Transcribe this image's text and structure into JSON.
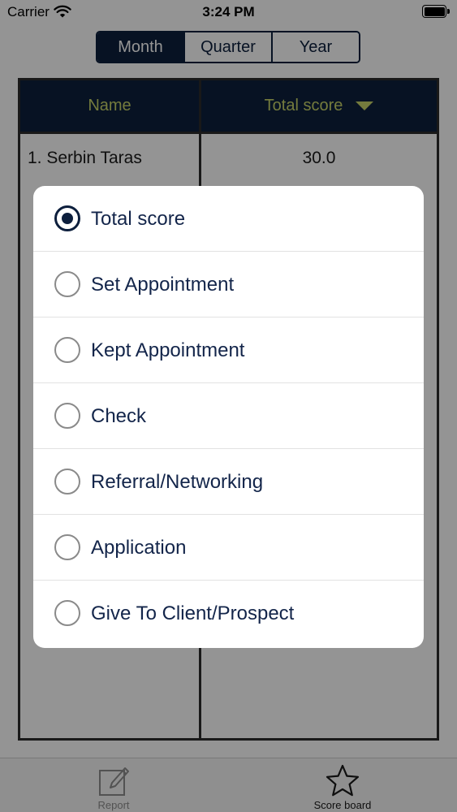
{
  "status_bar": {
    "carrier": "Carrier",
    "time": "3:24 PM"
  },
  "segmented": {
    "items": [
      "Month",
      "Quarter",
      "Year"
    ],
    "selected": "Month"
  },
  "table": {
    "headers": {
      "name": "Name",
      "score": "Total score"
    },
    "rows": [
      {
        "name": "1. Serbin Taras",
        "score": "30.0"
      }
    ]
  },
  "tab_bar": {
    "report_label": "Report",
    "score_label": "Score board"
  },
  "sort_menu": {
    "selected": "Total score",
    "options": [
      "Total score",
      "Set Appointment",
      "Kept Appointment",
      "Check",
      "Referral/Networking",
      "Application",
      "Give To Client/Prospect"
    ]
  },
  "colors": {
    "navy": "#0d1f3d",
    "header_text": "#c8d46a"
  }
}
